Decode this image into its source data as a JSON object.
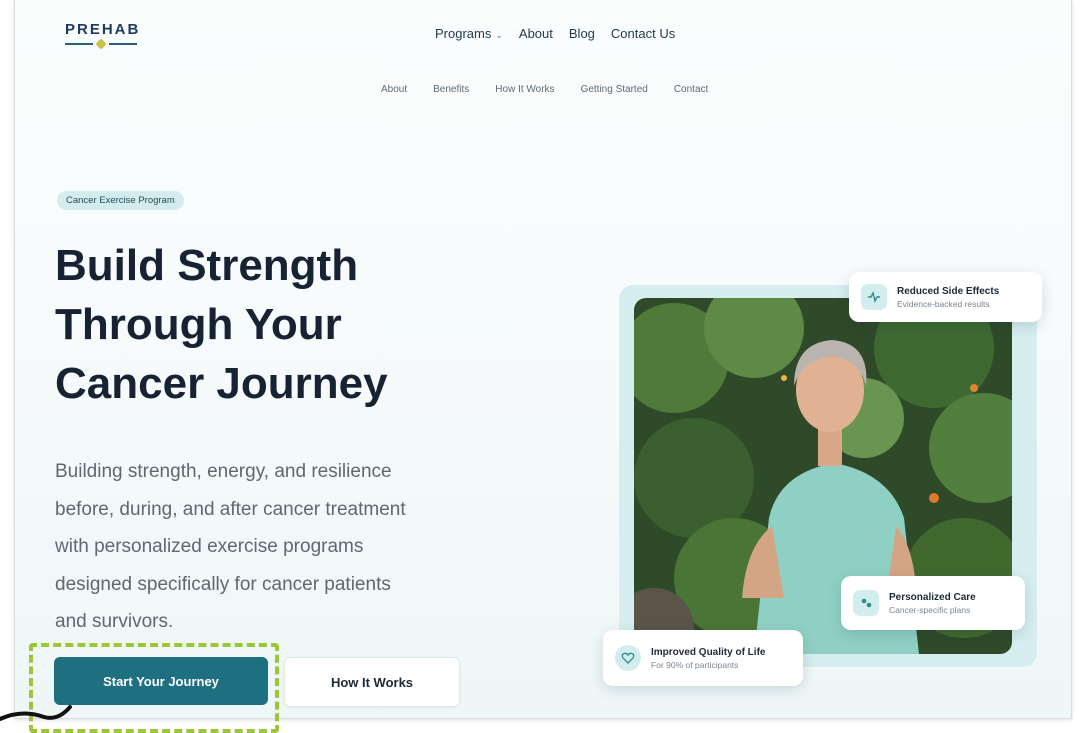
{
  "brand": {
    "logo_text": "PREHAB"
  },
  "nav": {
    "items": [
      {
        "label": "Programs",
        "has_dropdown": true
      },
      {
        "label": "About"
      },
      {
        "label": "Blog"
      },
      {
        "label": "Contact Us"
      }
    ]
  },
  "subnav": {
    "items": [
      "About",
      "Benefits",
      "How It Works",
      "Getting Started",
      "Contact"
    ]
  },
  "hero": {
    "badge": "Cancer Exercise Program",
    "title_lines": [
      "Build Strength",
      "Through Your",
      "Cancer Journey"
    ],
    "subtitle_lines": [
      "Building strength, energy, and resilience",
      "before, during, and after cancer treatment",
      "with personalized exercise programs",
      "designed specifically for cancer patients",
      "and survivors."
    ],
    "primary_button": "Start Your Journey",
    "secondary_button": "How It Works"
  },
  "cards": [
    {
      "title": "Reduced Side Effects",
      "subtitle": "Evidence-backed results",
      "icon": "activity-icon"
    },
    {
      "title": "Personalized Care",
      "subtitle": "Cancer-specific plans",
      "icon": "users-icon"
    },
    {
      "title": "Improved Quality of Life",
      "subtitle": "For 90% of participants",
      "icon": "heart-icon"
    }
  ],
  "colors": {
    "accent": "#1e6f80",
    "badge_bg": "#d4ecee",
    "highlight": "#9bc735",
    "title": "#172332"
  }
}
